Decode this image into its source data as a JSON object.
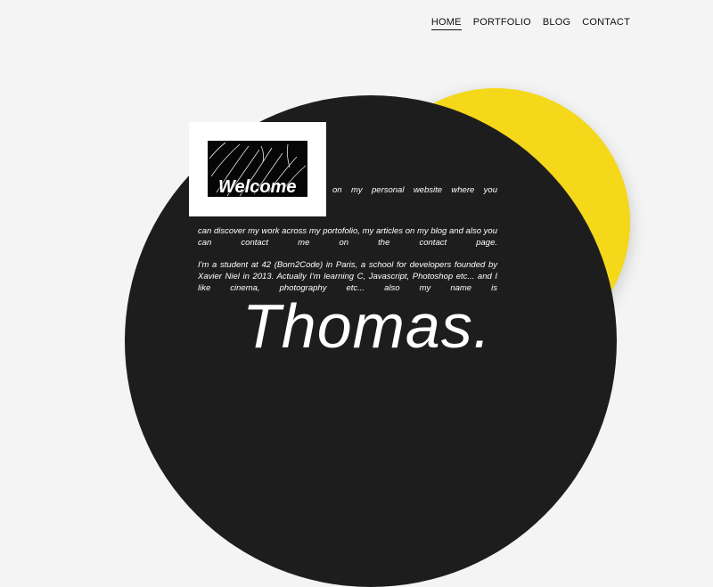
{
  "nav": {
    "items": [
      {
        "label": "HOME",
        "active": true
      },
      {
        "label": "PORTFOLIO",
        "active": false
      },
      {
        "label": "BLOG",
        "active": false
      },
      {
        "label": "CONTACT",
        "active": false
      }
    ]
  },
  "colors": {
    "background": "#f3f4f3",
    "accent_yellow": "#f4d819",
    "dark_circle": "#1e1d1d"
  },
  "hero": {
    "welcome_word": "Welcome",
    "intro_tail": "on my personal website where you",
    "paragraph_1": "can discover my work across my portofolio, my articles on my blog and also you can contact me on the contact page.",
    "paragraph_2": "I'm a student at 42 (Born2Code) in Paris, a school for developers founded by Xavier Niel in 2013. Actually I'm learning C, Javascript, Photoshop etc... and I like cinema, photography etc... also my name is",
    "name": "Thomas."
  }
}
